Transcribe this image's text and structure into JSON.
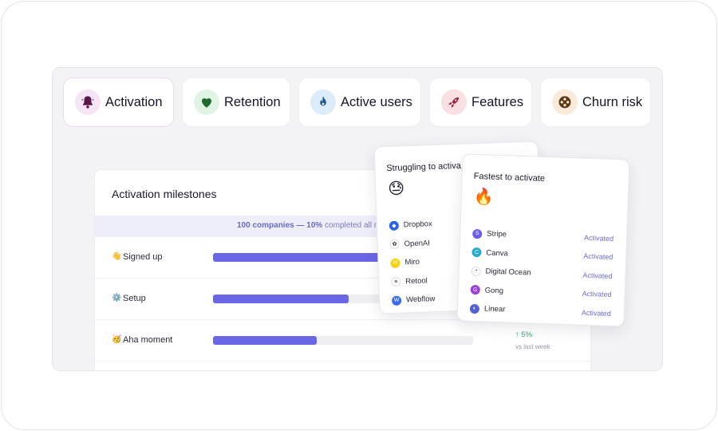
{
  "tabs": [
    {
      "label": "Activation",
      "icon": "bell-icon",
      "bg": "#f6e4f7",
      "fg": "#5a1848"
    },
    {
      "label": "Retention",
      "icon": "heart-icon",
      "bg": "#dff4e3",
      "fg": "#1f6b2e"
    },
    {
      "label": "Active users",
      "icon": "flame-icon",
      "bg": "#dcecfb",
      "fg": "#1c4f95"
    },
    {
      "label": "Features",
      "icon": "rocket-icon",
      "bg": "#fadfe3",
      "fg": "#a0243a"
    },
    {
      "label": "Churn risk",
      "icon": "film-reel-icon",
      "bg": "#f9ead9",
      "fg": "#5e3a12"
    }
  ],
  "card": {
    "title": "Activation milestones",
    "summary_bold": "100 companies — 10%",
    "summary_rest": " completed all mile",
    "rows": [
      {
        "emoji": "👋",
        "label": "Signed up",
        "progress": 0.64
      },
      {
        "emoji": "⚙️",
        "label": "Setup",
        "progress": 0.52
      },
      {
        "emoji": "🥳",
        "label": "Aha moment",
        "progress": 0.4,
        "delta": "↑ 5%",
        "delta_sub": "vs last week"
      }
    ]
  },
  "struggling": {
    "title": "Struggling to activa",
    "emoji": "😓",
    "items": [
      {
        "name": "Dropbox",
        "logo_color": "#2b63e8",
        "glyph": "◆"
      },
      {
        "name": "OpenAI",
        "logo_color": "#ffffff",
        "glyph": "✿"
      },
      {
        "name": "Miro",
        "logo_color": "#f5d01c",
        "glyph": "M"
      },
      {
        "name": "Retool",
        "logo_color": "#ffffff",
        "glyph": "≡"
      },
      {
        "name": "Webflow",
        "logo_color": "#3a6af0",
        "glyph": "W"
      }
    ]
  },
  "fastest": {
    "title": "Fastest to activate",
    "emoji": "🔥",
    "items": [
      {
        "name": "Stripe",
        "status": "Activated",
        "logo_color": "#6a5cf0",
        "glyph": "S"
      },
      {
        "name": "Canva",
        "status": "Activated",
        "logo_color": "#2aa9c9",
        "glyph": "C"
      },
      {
        "name": "Digital Ocean",
        "status": "Activated",
        "logo_color": "#ffffff",
        "glyph": "◔"
      },
      {
        "name": "Gong",
        "status": "Activated",
        "logo_color": "#9b3fd6",
        "glyph": "G"
      },
      {
        "name": "Linear",
        "status": "Activated",
        "logo_color": "#5462d8",
        "glyph": "◐"
      }
    ]
  }
}
